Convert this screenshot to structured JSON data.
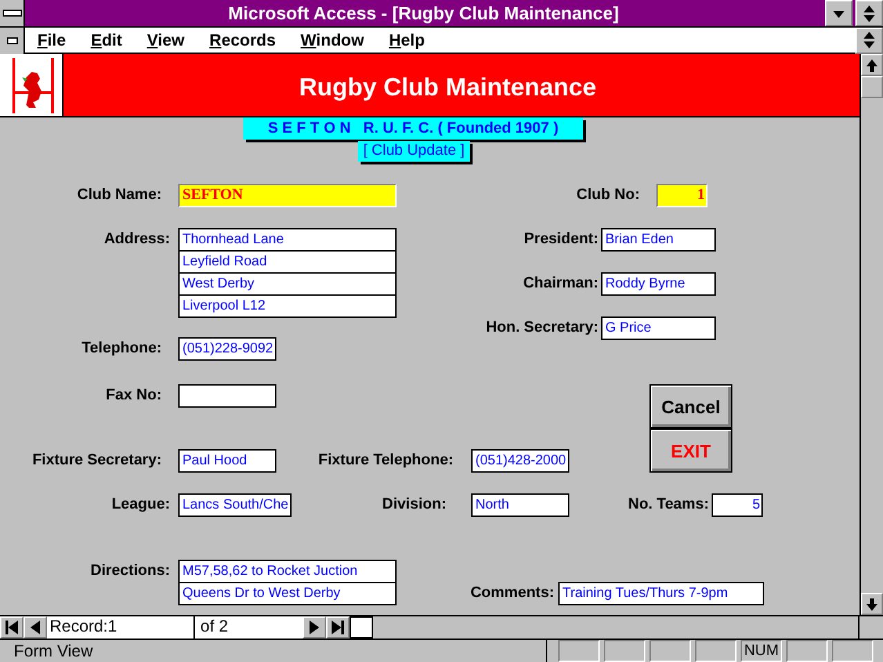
{
  "window": {
    "title": "Microsoft Access - [Rugby Club Maintenance]"
  },
  "menu": [
    "File",
    "Edit",
    "View",
    "Records",
    "Window",
    "Help"
  ],
  "header": {
    "title": "Rugby Club Maintenance",
    "banner": "S E F T O N   R. U. F. C. ( Founded 1907 )",
    "subtitle": "[ Club Update ]"
  },
  "fields": [
    {
      "label": "Club Name:",
      "value": "SEFTON",
      "kind": "text",
      "highlighted": true
    },
    {
      "label": "Club No:",
      "value": "1",
      "kind": "number",
      "highlighted": true
    },
    {
      "label": "Address:",
      "lines": [
        "Thornhead Lane",
        "Leyfield Road",
        "West Derby",
        "Liverpool  L12"
      ],
      "kind": "text",
      "highlighted": false
    },
    {
      "label": "President:",
      "value": "Brian Eden",
      "kind": "text",
      "highlighted": false
    },
    {
      "label": "Chairman:",
      "value": "Roddy Byrne",
      "kind": "text",
      "highlighted": false
    },
    {
      "label": "Hon. Secretary:",
      "value": "G Price",
      "kind": "text",
      "highlighted": false
    },
    {
      "label": "Telephone:",
      "value": "(051)228-9092",
      "kind": "text",
      "highlighted": false
    },
    {
      "label": "Fax No:",
      "kind": "text",
      "highlighted": false
    },
    {
      "label": "Fixture Secretary:",
      "value": "Paul Hood",
      "kind": "text",
      "highlighted": false
    },
    {
      "label": "Fixture Telephone:",
      "value": "(051)428-2000",
      "kind": "text",
      "highlighted": false
    },
    {
      "label": "League:",
      "value": "Lancs South/Che",
      "kind": "text",
      "highlighted": false
    },
    {
      "label": "Division:",
      "value": "North",
      "kind": "text",
      "highlighted": false
    },
    {
      "label": "No. Teams:",
      "value": "5",
      "kind": "number",
      "highlighted": false
    },
    {
      "label": "Directions:",
      "lines": [
        "M57,58,62 to Rocket Juction",
        "Queens Dr to West Derby"
      ],
      "kind": "text",
      "highlighted": false
    },
    {
      "label": "Comments:",
      "value": "Training Tues/Thurs 7-9pm",
      "kind": "text",
      "highlighted": false
    }
  ],
  "buttons": [
    {
      "label": "Cancel",
      "kind": "normal"
    },
    {
      "label": "EXIT",
      "kind": "warning"
    }
  ],
  "navigation": {
    "label": "Record:",
    "value": "1",
    "total": "of  2"
  },
  "status_bar": {
    "text": "Form View",
    "num_lock": "NUM"
  }
}
